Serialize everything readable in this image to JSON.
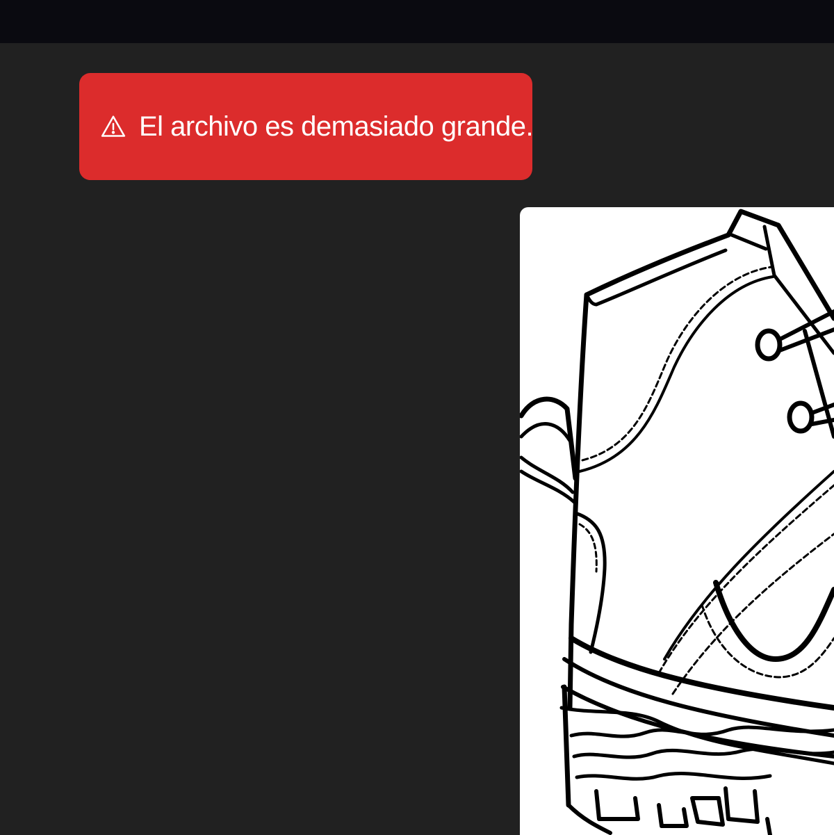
{
  "toast": {
    "icon": "warning-triangle-icon",
    "message": "El archivo es demasiado grande.",
    "color": "#dc2c2c"
  },
  "preview": {
    "subject": "boot-line-drawing"
  },
  "colors": {
    "background": "#212121",
    "top_bar": "#0a0a10",
    "card": "#ffffff"
  }
}
